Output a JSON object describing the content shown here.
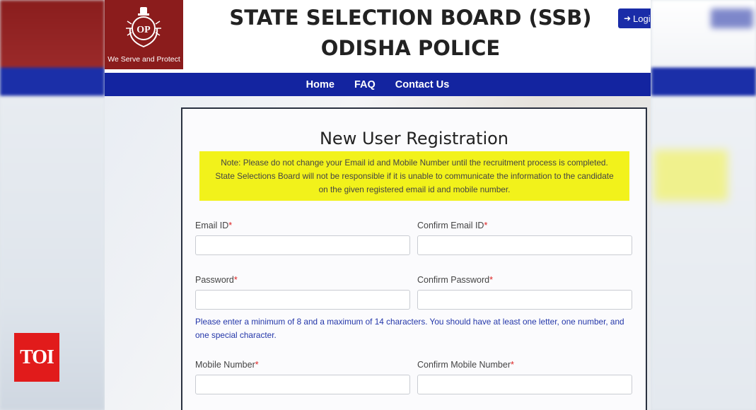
{
  "header": {
    "title_line1": "STATE SELECTION BOARD (SSB)",
    "title_line2": "ODISHA POLICE",
    "logo_motto": "We Serve and Protect",
    "login_label": "Logi"
  },
  "nav": {
    "items": [
      {
        "label": "Home"
      },
      {
        "label": "FAQ"
      },
      {
        "label": "Contact Us"
      }
    ]
  },
  "form": {
    "title": "New User Registration",
    "note_line1": "Note: Please do not change your Email id and Mobile Number until the recruitment process is completed.",
    "note_line2": "State Selections Board will not be responsible if it is unable to communicate the information to the candidate",
    "note_line3": "on the given registered email id and mobile number.",
    "required_marker": "*",
    "fields": {
      "email": {
        "label": "Email ID",
        "value": ""
      },
      "confirm_email": {
        "label": "Confirm Email ID",
        "value": ""
      },
      "password": {
        "label": "Password",
        "value": ""
      },
      "confirm_password": {
        "label": "Confirm Password",
        "value": ""
      },
      "mobile": {
        "label": "Mobile Number",
        "value": ""
      },
      "confirm_mobile": {
        "label": "Confirm Mobile Number",
        "value": ""
      }
    },
    "password_hint_line1": "Please enter a minimum of 8 and a maximum of 14 characters. You should have at least one letter, one number, and",
    "password_hint_line2": "one special character."
  },
  "badge": {
    "text": "TOI"
  },
  "colors": {
    "nav_bg": "#1324a0",
    "logo_bg": "#8b1c1c",
    "note_bg": "#f2f21b",
    "hint_text": "#2336a9",
    "required": "#dd2222",
    "badge_bg": "#e11b1b"
  }
}
